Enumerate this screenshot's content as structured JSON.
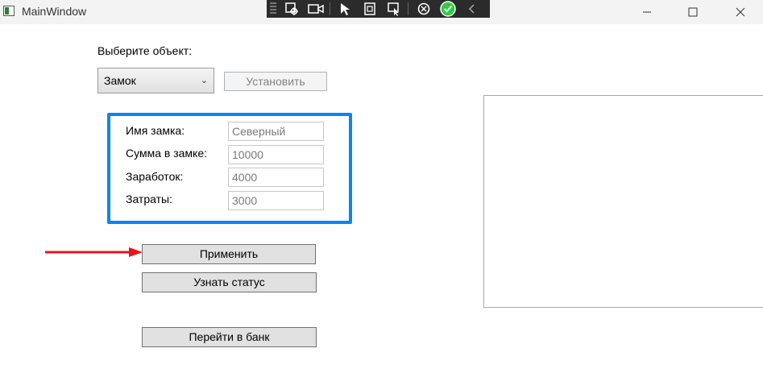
{
  "window": {
    "title": "MainWindow",
    "minimize_icon": "minimize-icon",
    "maximize_icon": "maximize-icon",
    "close_icon": "close-icon"
  },
  "debug_toolbar": {
    "icons": [
      "select-element-icon",
      "video-icon",
      "cursor-icon",
      "square-icon",
      "layout-cursor-icon",
      "hot-reload-icon",
      "check-icon",
      "chevron-left-icon"
    ],
    "check_color": "#2ecc40"
  },
  "form": {
    "select_label": "Выберите объект:",
    "combo_value": "Замок",
    "set_button": "Установить",
    "fields": [
      {
        "label": "Имя замка:",
        "value": "Северный"
      },
      {
        "label": "Сумма в замке:",
        "value": "10000"
      },
      {
        "label": "Заработок:",
        "value": "4000"
      },
      {
        "label": "Затраты:",
        "value": "3000"
      }
    ],
    "apply_button": "Применить",
    "status_button": "Узнать статус",
    "bank_button": "Перейти в банк"
  },
  "annotations": {
    "highlight_color": "#0a84f5",
    "arrow_color": "#e8141c"
  }
}
